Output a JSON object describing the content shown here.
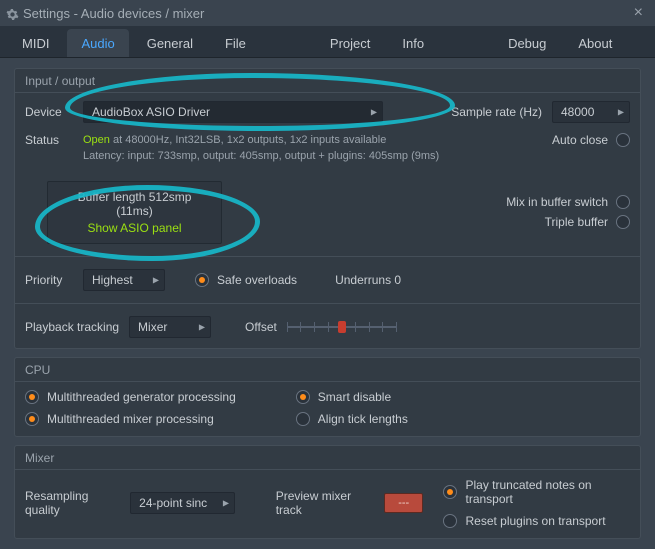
{
  "window": {
    "title": "Settings - Audio devices / mixer"
  },
  "tabs": {
    "midi": "MIDI",
    "audio": "Audio",
    "general": "General",
    "file": "File",
    "project": "Project",
    "info": "Info",
    "debug": "Debug",
    "about": "About",
    "active": "audio"
  },
  "io_section": {
    "header": "Input / output",
    "device_label": "Device",
    "device_value": "AudioBox ASIO Driver",
    "sample_rate_label": "Sample rate (Hz)",
    "sample_rate_value": "48000",
    "status_label": "Status",
    "status_open": "Open",
    "status_line1_rest": " at 48000Hz, Int32LSB, 1x2 outputs, 1x2 inputs available",
    "status_line2": "Latency: input: 733smp, output: 405smp, output + plugins: 405smp (9ms)",
    "auto_close_label": "Auto close",
    "buffer_line1": "Buffer length 512smp (11ms)",
    "buffer_line2": "Show ASIO panel",
    "mix_in_buffer_label": "Mix in buffer switch",
    "triple_buffer_label": "Triple buffer",
    "priority_label": "Priority",
    "priority_value": "Highest",
    "safe_overloads_label": "Safe overloads",
    "underruns_label": "Underruns 0",
    "playback_tracking_label": "Playback tracking",
    "playback_tracking_value": "Mixer",
    "offset_label": "Offset"
  },
  "cpu_section": {
    "header": "CPU",
    "mt_gen": "Multithreaded generator processing",
    "mt_mixer": "Multithreaded mixer processing",
    "smart_disable": "Smart disable",
    "align_tick": "Align tick lengths"
  },
  "mixer_section": {
    "header": "Mixer",
    "resampling_label": "Resampling quality",
    "resampling_value": "24-point sinc",
    "preview_track_label": "Preview mixer track",
    "preview_track_value": "---",
    "play_truncated": "Play truncated notes on transport",
    "reset_plugins": "Reset plugins on transport"
  }
}
